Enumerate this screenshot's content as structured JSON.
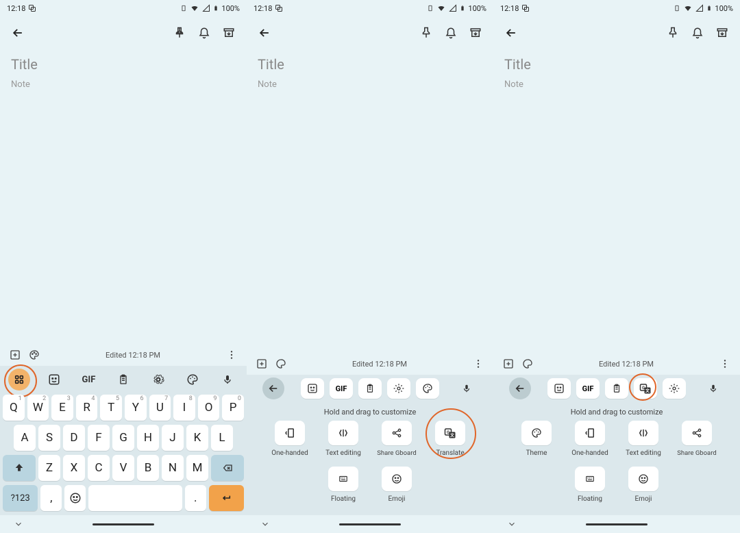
{
  "status": {
    "time": "12:18",
    "battery": "100%"
  },
  "note": {
    "title_placeholder": "Title",
    "body_placeholder": "Note",
    "edited": "Edited 12:18 PM"
  },
  "kb": {
    "row1": [
      {
        "k": "Q",
        "s": "1"
      },
      {
        "k": "W",
        "s": "2"
      },
      {
        "k": "E",
        "s": "3"
      },
      {
        "k": "R",
        "s": "4"
      },
      {
        "k": "T",
        "s": "5"
      },
      {
        "k": "Y",
        "s": "6"
      },
      {
        "k": "U",
        "s": "7"
      },
      {
        "k": "I",
        "s": "8"
      },
      {
        "k": "O",
        "s": "9"
      },
      {
        "k": "P",
        "s": "0"
      }
    ],
    "row2": [
      "A",
      "S",
      "D",
      "F",
      "G",
      "H",
      "J",
      "K",
      "L"
    ],
    "row3": [
      "Z",
      "X",
      "C",
      "V",
      "B",
      "N",
      "M"
    ],
    "sym": "?123",
    "comma": ",",
    "period": ".",
    "gif": "GIF"
  },
  "panel": {
    "hint": "Hold and drag to customize",
    "tools_a": [
      "One-handed",
      "Text editing",
      "Share Gboard",
      "Translate",
      "Floating",
      "Emoji"
    ],
    "tools_b": [
      "Theme",
      "One-handed",
      "Text editing",
      "Share Gboard",
      "Floating",
      "Emoji"
    ],
    "gif": "GIF"
  }
}
